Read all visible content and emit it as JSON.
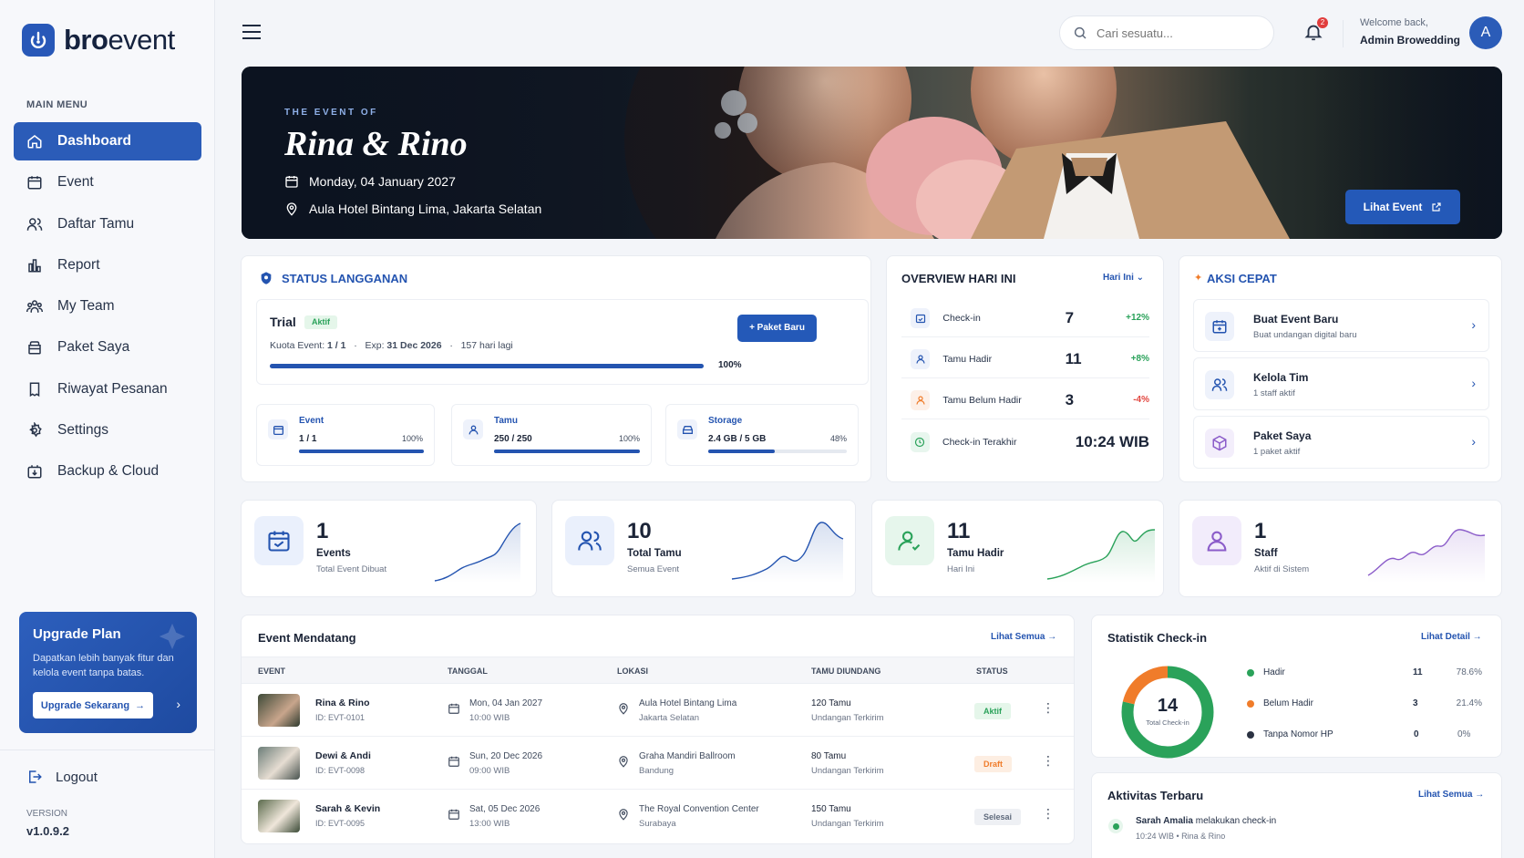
{
  "brand": {
    "name_bold": "bro",
    "name_rest": "event"
  },
  "sidebar": {
    "section_label": "MAIN MENU",
    "items": [
      {
        "label": "Dashboard",
        "icon": "home-icon",
        "active": true
      },
      {
        "label": "Event",
        "icon": "calendar-icon"
      },
      {
        "label": "Daftar Tamu",
        "icon": "users-icon"
      },
      {
        "label": "Report",
        "icon": "bar-chart-icon"
      },
      {
        "label": "My Team",
        "icon": "team-icon"
      },
      {
        "label": "Paket Saya",
        "icon": "package-icon"
      },
      {
        "label": "Riwayat Pesanan",
        "icon": "receipt-icon"
      },
      {
        "label": "Settings",
        "icon": "gear-icon"
      },
      {
        "label": "Backup & Cloud",
        "icon": "cloud-backup-icon"
      }
    ],
    "upgrade": {
      "title": "Upgrade Plan",
      "desc": "Dapatkan lebih banyak fitur dan kelola event tanpa batas.",
      "button": "Upgrade Sekarang"
    },
    "logout": "Logout",
    "version_label": "VERSION",
    "version": "v1.0.9.2"
  },
  "header": {
    "search_placeholder": "Cari sesuatu...",
    "notif_count": "2",
    "welcome": "Welcome back,",
    "user_name": "Admin Browedding",
    "avatar_initial": "A"
  },
  "hero": {
    "eyebrow": "THE EVENT OF",
    "title": "Rina & Rino",
    "date": "Monday, 04 January 2027",
    "location": "Aula Hotel Bintang Lima, Jakarta Selatan",
    "button": "Lihat Event"
  },
  "subscription": {
    "title": "STATUS LANGGANAN",
    "plan": "Trial",
    "status": "Aktif",
    "quota_label": "Kuota Event:",
    "quota": "1 / 1",
    "exp_label": "Exp:",
    "exp": "31 Dec 2026",
    "days_left": "157 hari lagi",
    "progress_label": "100%",
    "progress": 1.0,
    "new_button": "+ Paket Baru",
    "usage": [
      {
        "label": "Event",
        "value": "1 / 1",
        "pct": "100%",
        "fill": 1.0,
        "icon": "calendar-icon"
      },
      {
        "label": "Tamu",
        "value": "250 / 250",
        "pct": "100%",
        "fill": 1.0,
        "icon": "user-icon"
      },
      {
        "label": "Storage",
        "value": "2.4 GB / 5 GB",
        "pct": "48%",
        "fill": 0.48,
        "icon": "storage-icon"
      }
    ]
  },
  "overview": {
    "title": "OVERVIEW HARI INI",
    "filter": "Hari Ini",
    "rows": [
      {
        "label": "Check-in",
        "value": "7",
        "delta": "+12%",
        "color": "#2aa25a"
      },
      {
        "label": "Tamu Hadir",
        "value": "11",
        "delta": "+8%",
        "color": "#2aa25a"
      },
      {
        "label": "Tamu Belum Hadir",
        "value": "3",
        "delta": "-4%",
        "color": "#e2463f"
      },
      {
        "label": "Check-in Terakhir",
        "value": "10:24 WIB",
        "delta": ""
      }
    ]
  },
  "quick_actions": {
    "title": "AKSI CEPAT",
    "items": [
      {
        "title": "Buat Event Baru",
        "sub": "Buat undangan digital baru",
        "icon": "calendar-plus-icon"
      },
      {
        "title": "Kelola Tim",
        "sub": "1 staff aktif",
        "icon": "team-icon"
      },
      {
        "title": "Paket Saya",
        "sub": "1 paket aktif",
        "icon": "box-icon"
      }
    ]
  },
  "stats": [
    {
      "value": "1",
      "label": "Events",
      "sub": "Total Event Dibuat",
      "color": "#2454b0"
    },
    {
      "value": "10",
      "label": "Total Tamu",
      "sub": "Semua Event",
      "color": "#2454b0"
    },
    {
      "value": "11",
      "label": "Tamu Hadir",
      "sub": "Hari Ini",
      "color": "#2aa25a"
    },
    {
      "value": "1",
      "label": "Staff",
      "sub": "Aktif di Sistem",
      "color": "#8b5cc9"
    }
  ],
  "upcoming": {
    "title": "Event Mendatang",
    "link": "Lihat Semua",
    "columns": [
      "EVENT",
      "TANGGAL",
      "LOKASI",
      "TAMU DIUNDANG",
      "STATUS"
    ],
    "rows": [
      {
        "name": "Rina & Rino",
        "id": "ID: EVT-0101",
        "date": "Mon, 04 Jan 2027",
        "time": "10:00 WIB",
        "loc1": "Aula Hotel Bintang Lima",
        "loc2": "Jakarta Selatan",
        "guests": "120 Tamu",
        "guests_sub": "Undangan Terkirim",
        "status": "Aktif"
      },
      {
        "name": "Dewi & Andi",
        "id": "ID: EVT-0098",
        "date": "Sun, 20 Dec 2026",
        "time": "09:00 WIB",
        "loc1": "Graha Mandiri Ballroom",
        "loc2": "Bandung",
        "guests": "80 Tamu",
        "guests_sub": "Undangan Terkirim",
        "status": "Draft"
      },
      {
        "name": "Sarah & Kevin",
        "id": "ID: EVT-0095",
        "date": "Sat, 05 Dec 2026",
        "time": "13:00 WIB",
        "loc1": "The Royal Convention Center",
        "loc2": "Surabaya",
        "guests": "150 Tamu",
        "guests_sub": "Undangan Terkirim",
        "status": "Selesai"
      }
    ]
  },
  "checkin_stats": {
    "title": "Statistik Check-in",
    "link": "Lihat Detail",
    "total": "14",
    "total_label": "Total Check-in",
    "legend": [
      {
        "label": "Hadir",
        "count": "11",
        "pct": "78.6%",
        "color": "#2aa25a",
        "share": 0.786
      },
      {
        "label": "Belum Hadir",
        "count": "3",
        "pct": "21.4%",
        "color": "#f07c2a",
        "share": 0.214
      },
      {
        "label": "Tanpa Nomor HP",
        "count": "0",
        "pct": "0%",
        "color": "#2b3242",
        "share": 0
      }
    ]
  },
  "activity": {
    "title": "Aktivitas Terbaru",
    "link": "Lihat Semua",
    "items": [
      {
        "actor": "Sarah Amalia",
        "action": "melakukan check-in",
        "meta": "10:24 WIB • Rina & Rino"
      }
    ]
  }
}
